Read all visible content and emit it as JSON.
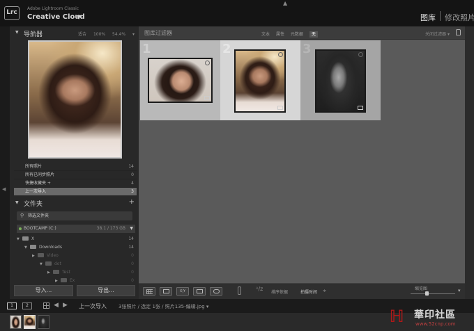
{
  "app": {
    "logo": "Lrc",
    "brand_small": "Adobe Lightroom Classic",
    "brand_large": "Creative Cloud",
    "brand_caret": "▼",
    "top_arrow": "▲",
    "modules": [
      "图库",
      "修改照片"
    ]
  },
  "navigator": {
    "triangle": "▼",
    "title": "导航器",
    "options": [
      "适合",
      "100%",
      "54.4%",
      "▾"
    ]
  },
  "catalog": [
    {
      "label": "所有照片",
      "count": "14"
    },
    {
      "label": "所有已同步照片",
      "count": "0"
    },
    {
      "label": "快捷收藏夹 +",
      "count": "4"
    },
    {
      "label": "上一次导入",
      "count": "3"
    }
  ],
  "folders": {
    "triangle": "▼",
    "title": "文件夹",
    "add": "+",
    "filter_icon": "⚲",
    "filter_label": "筛选文件夹",
    "volume_name": "BOOTCAMP (C:)",
    "volume_size": "38.1 / 173 GB",
    "volume_caret": "▼",
    "tree": [
      {
        "tri": "▼",
        "label": "X",
        "count": "14",
        "indent": 0,
        "dim": false
      },
      {
        "tri": "▼",
        "label": "Downloads",
        "count": "14",
        "indent": 1,
        "dim": false
      },
      {
        "tri": "▶",
        "label": "Video",
        "count": "0",
        "indent": 2,
        "dim": true
      },
      {
        "tri": "▼",
        "label": "dot",
        "count": "0",
        "indent": 3,
        "dim": true
      },
      {
        "tri": "▶",
        "label": "Test",
        "count": "0",
        "indent": 4,
        "dim": true
      },
      {
        "tri": "▶",
        "label": "Ex",
        "count": "0",
        "indent": 5,
        "dim": true
      }
    ]
  },
  "buttons": {
    "import": "导入...",
    "export": "导出..."
  },
  "filter_bar": {
    "title": "图库过滤器",
    "options": [
      {
        "label": "文本",
        "active": false
      },
      {
        "label": "属性",
        "active": false
      },
      {
        "label": "元数据",
        "active": false
      },
      {
        "label": "无",
        "active": true
      }
    ],
    "off_label": "关闭过滤器",
    "off_caret": "▾"
  },
  "grid": [
    {
      "num": "1",
      "state": "normal",
      "photo": "photo1"
    },
    {
      "num": "2",
      "state": "selected",
      "photo": "photo2"
    },
    {
      "num": "3",
      "state": "dark",
      "photo": "photo3"
    }
  ],
  "toolbar": {
    "sort_label": "排序依据",
    "sort_value": "拍摄时间",
    "sort_caret": "≑",
    "sort_glyph": "ᴬ/z",
    "thumb_label": "缩览图",
    "drop": "▾",
    "compare_label": "X|Y",
    "slider_level": 0.36
  },
  "filmstrip": {
    "screens": [
      "1",
      "2"
    ],
    "arrow_left": "◀",
    "arrow_right": "▶",
    "source": "上一次导入",
    "info": "3张照片 / 选定 1张 / 照片135-编辑.jpg ▾"
  },
  "watermark": {
    "text": "華印社區",
    "url": "www.52cnp.com"
  },
  "colors": {
    "panel": "#282828",
    "grid_bg": "#5a5a5a",
    "cell": "#b9b9b9",
    "cell_selected": "#d6d6d6"
  }
}
